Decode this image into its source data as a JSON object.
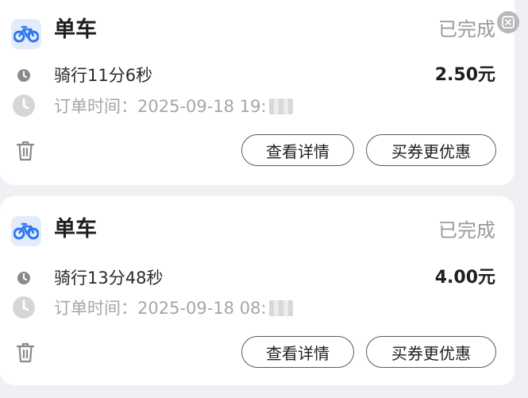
{
  "orders": [
    {
      "type_label": "单车",
      "status": "已完成",
      "ride_text": "骑行11分6秒",
      "price": "2.50元",
      "order_time": "订单时间：2025-09-18 19:",
      "buttons": {
        "detail": "查看详情",
        "coupon": "买券更优惠"
      }
    },
    {
      "type_label": "单车",
      "status": "已完成",
      "ride_text": "骑行13分48秒",
      "price": "4.00元",
      "order_time": "订单时间：2025-09-18 08:",
      "buttons": {
        "detail": "查看详情",
        "coupon": "买券更优惠"
      }
    }
  ],
  "colors": {
    "bike_blue": "#2f78f0",
    "bike_badge_bg": "#e3ecfb",
    "status_gray": "#9a9a9a",
    "button_border": "#5a5a5a"
  },
  "icons": [
    "bicycle-icon",
    "clock-icon",
    "time-icon",
    "trash-icon",
    "close-icon"
  ]
}
